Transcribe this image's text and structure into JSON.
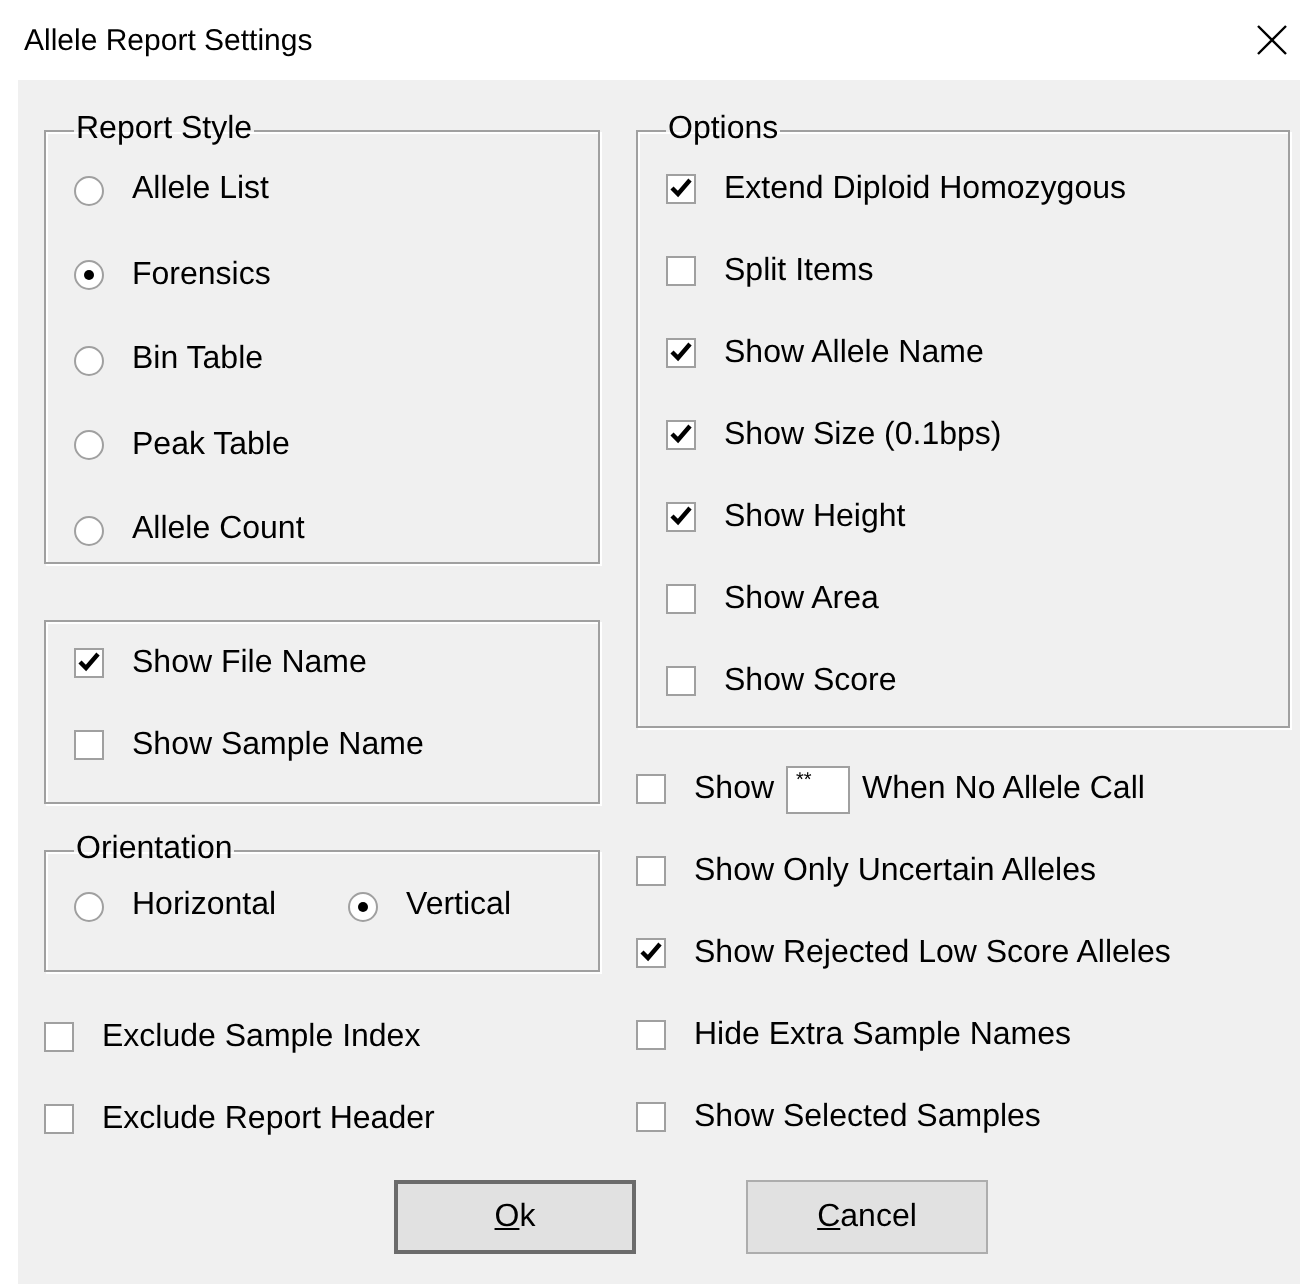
{
  "window": {
    "title": "Allele Report Settings"
  },
  "report_style": {
    "legend": "Report Style",
    "options": [
      {
        "label": "Allele List",
        "selected": false
      },
      {
        "label": "Forensics",
        "selected": true
      },
      {
        "label": "Bin Table",
        "selected": false
      },
      {
        "label": "Peak Table",
        "selected": false
      },
      {
        "label": "Allele Count",
        "selected": false
      }
    ]
  },
  "name_options": [
    {
      "label": "Show File Name",
      "checked": true
    },
    {
      "label": "Show Sample Name",
      "checked": false
    }
  ],
  "orientation": {
    "legend": "Orientation",
    "options": [
      {
        "label": "Horizontal",
        "selected": false
      },
      {
        "label": "Vertical",
        "selected": true
      }
    ]
  },
  "left_checks": [
    {
      "label": "Exclude Sample Index",
      "checked": false
    },
    {
      "label": "Exclude Report Header",
      "checked": false
    }
  ],
  "options": {
    "legend": "Options",
    "items": [
      {
        "label": "Extend Diploid Homozygous",
        "checked": true
      },
      {
        "label": "Split Items",
        "checked": false
      },
      {
        "label": "Show Allele Name",
        "checked": true
      },
      {
        "label": "Show Size (0.1bps)",
        "checked": true
      },
      {
        "label": "Show Height",
        "checked": true
      },
      {
        "label": "Show Area",
        "checked": false
      },
      {
        "label": "Show Score",
        "checked": false
      }
    ]
  },
  "no_call": {
    "checked": false,
    "label_before": "Show",
    "value": "**",
    "label_after": "When No Allele Call"
  },
  "right_checks": [
    {
      "label": "Show Only Uncertain Alleles",
      "checked": false
    },
    {
      "label": "Show Rejected Low Score Alleles",
      "checked": true
    },
    {
      "label": "Hide Extra Sample Names",
      "checked": false
    },
    {
      "label": "Show Selected Samples",
      "checked": false
    }
  ],
  "buttons": [
    {
      "label": "Ok",
      "kind": "default"
    },
    {
      "label": "Cancel",
      "kind": "normal"
    }
  ]
}
